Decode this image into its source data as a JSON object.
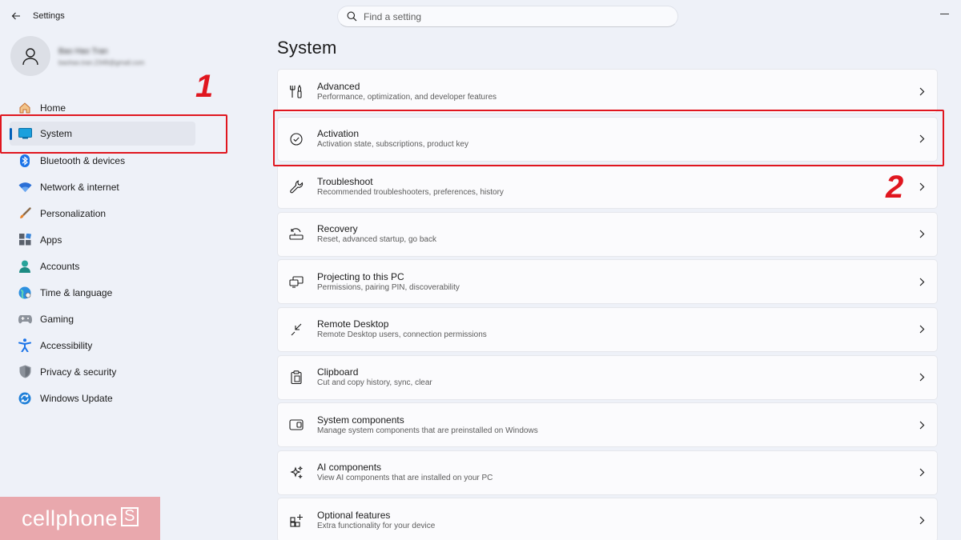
{
  "window": {
    "title": "Settings",
    "search_placeholder": "Find a setting"
  },
  "profile": {
    "name": "Bao Hao Tran",
    "email": "baohao.tran.2349@gmail.com"
  },
  "sidebar": {
    "items": [
      {
        "label": "Home",
        "icon": "home-icon"
      },
      {
        "label": "System",
        "icon": "system-icon",
        "active": true
      },
      {
        "label": "Bluetooth & devices",
        "icon": "bluetooth-icon"
      },
      {
        "label": "Network & internet",
        "icon": "wifi-icon"
      },
      {
        "label": "Personalization",
        "icon": "brush-icon"
      },
      {
        "label": "Apps",
        "icon": "apps-icon"
      },
      {
        "label": "Accounts",
        "icon": "accounts-icon"
      },
      {
        "label": "Time & language",
        "icon": "globe-icon"
      },
      {
        "label": "Gaming",
        "icon": "gamepad-icon"
      },
      {
        "label": "Accessibility",
        "icon": "accessibility-icon"
      },
      {
        "label": "Privacy & security",
        "icon": "shield-icon"
      },
      {
        "label": "Windows Update",
        "icon": "update-icon"
      }
    ]
  },
  "main": {
    "title": "System",
    "items": [
      {
        "title": "Advanced",
        "subtitle": "Performance, optimization, and developer features",
        "icon": "tools-icon"
      },
      {
        "title": "Activation",
        "subtitle": "Activation state, subscriptions, product key",
        "icon": "check-circle-icon"
      },
      {
        "title": "Troubleshoot",
        "subtitle": "Recommended troubleshooters, preferences, history",
        "icon": "wrench-icon"
      },
      {
        "title": "Recovery",
        "subtitle": "Reset, advanced startup, go back",
        "icon": "recovery-icon"
      },
      {
        "title": "Projecting to this PC",
        "subtitle": "Permissions, pairing PIN, discoverability",
        "icon": "projector-icon"
      },
      {
        "title": "Remote Desktop",
        "subtitle": "Remote Desktop users, connection permissions",
        "icon": "remote-desktop-icon"
      },
      {
        "title": "Clipboard",
        "subtitle": "Cut and copy history, sync, clear",
        "icon": "clipboard-icon"
      },
      {
        "title": "System components",
        "subtitle": "Manage system components that are preinstalled on Windows",
        "icon": "components-icon"
      },
      {
        "title": "AI components",
        "subtitle": "View AI components that are installed on your PC",
        "icon": "sparkle-icon"
      },
      {
        "title": "Optional features",
        "subtitle": "Extra functionality for your device",
        "icon": "add-features-icon"
      }
    ]
  },
  "annotations": {
    "step1": "1",
    "step2": "2",
    "color": "#e0161f"
  },
  "watermark": {
    "text": "cellphone",
    "suffix": "S"
  },
  "colors": {
    "accent": "#005fb8",
    "background": "#eef1f8",
    "card": "#fbfbfd"
  }
}
